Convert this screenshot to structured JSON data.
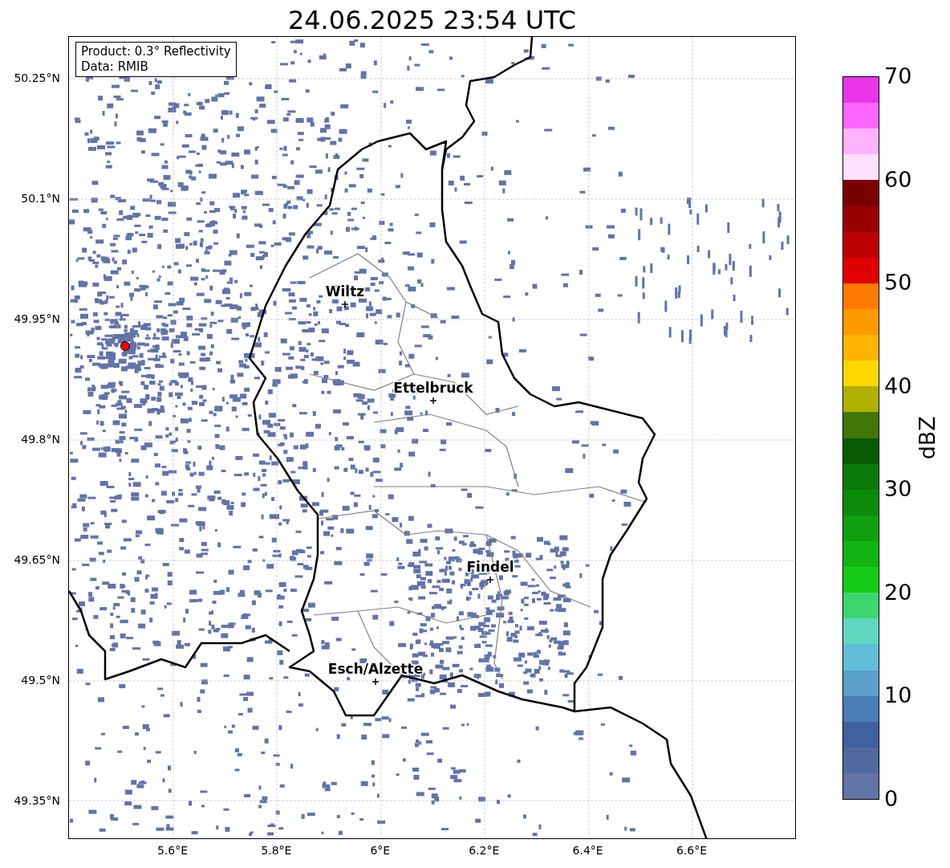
{
  "title": "24.06.2025 23:54 UTC",
  "info": [
    "Product: 0.3° Reflectivity",
    "Data: RMIB"
  ],
  "cities": [
    {
      "name": "Wiltz"
    },
    {
      "name": "Ettelbruck"
    },
    {
      "name": "Findel"
    },
    {
      "name": "Esch/Alzette"
    }
  ],
  "lat_ticks": [
    "50.25°N",
    "50.1°N",
    "49.95°N",
    "49.8°N",
    "49.65°N",
    "49.5°N",
    "49.35°N"
  ],
  "lon_ticks": [
    "5.6°E",
    "5.8°E",
    "6°E",
    "6.2°E",
    "6.4°E",
    "6.6°E"
  ],
  "colorbar": {
    "label": "dBZ",
    "ticks": [
      "70",
      "60",
      "50",
      "40",
      "30",
      "20",
      "10",
      "0"
    ],
    "segments": [
      {
        "color": "#e935e9"
      },
      {
        "color": "#ff66ff"
      },
      {
        "color": "#ffb3ff"
      },
      {
        "color": "#ffe0ff"
      },
      {
        "color": "#7a0000"
      },
      {
        "color": "#990000"
      },
      {
        "color": "#bb0000"
      },
      {
        "color": "#e00000"
      },
      {
        "color": "#ff7a00"
      },
      {
        "color": "#ff9900"
      },
      {
        "color": "#ffb400"
      },
      {
        "color": "#ffd700"
      },
      {
        "color": "#afb000"
      },
      {
        "color": "#417705"
      },
      {
        "color": "#075b07"
      },
      {
        "color": "#0a7a0a"
      },
      {
        "color": "#0c8a0c"
      },
      {
        "color": "#0f9f0f"
      },
      {
        "color": "#13b313"
      },
      {
        "color": "#17cc17"
      },
      {
        "color": "#3ed470"
      },
      {
        "color": "#60d6c0"
      },
      {
        "color": "#62bdd8"
      },
      {
        "color": "#5aa0c8"
      },
      {
        "color": "#4a7db5"
      },
      {
        "color": "#4160a0"
      },
      {
        "color": "#506aa0"
      },
      {
        "color": "#6273a8"
      }
    ]
  }
}
